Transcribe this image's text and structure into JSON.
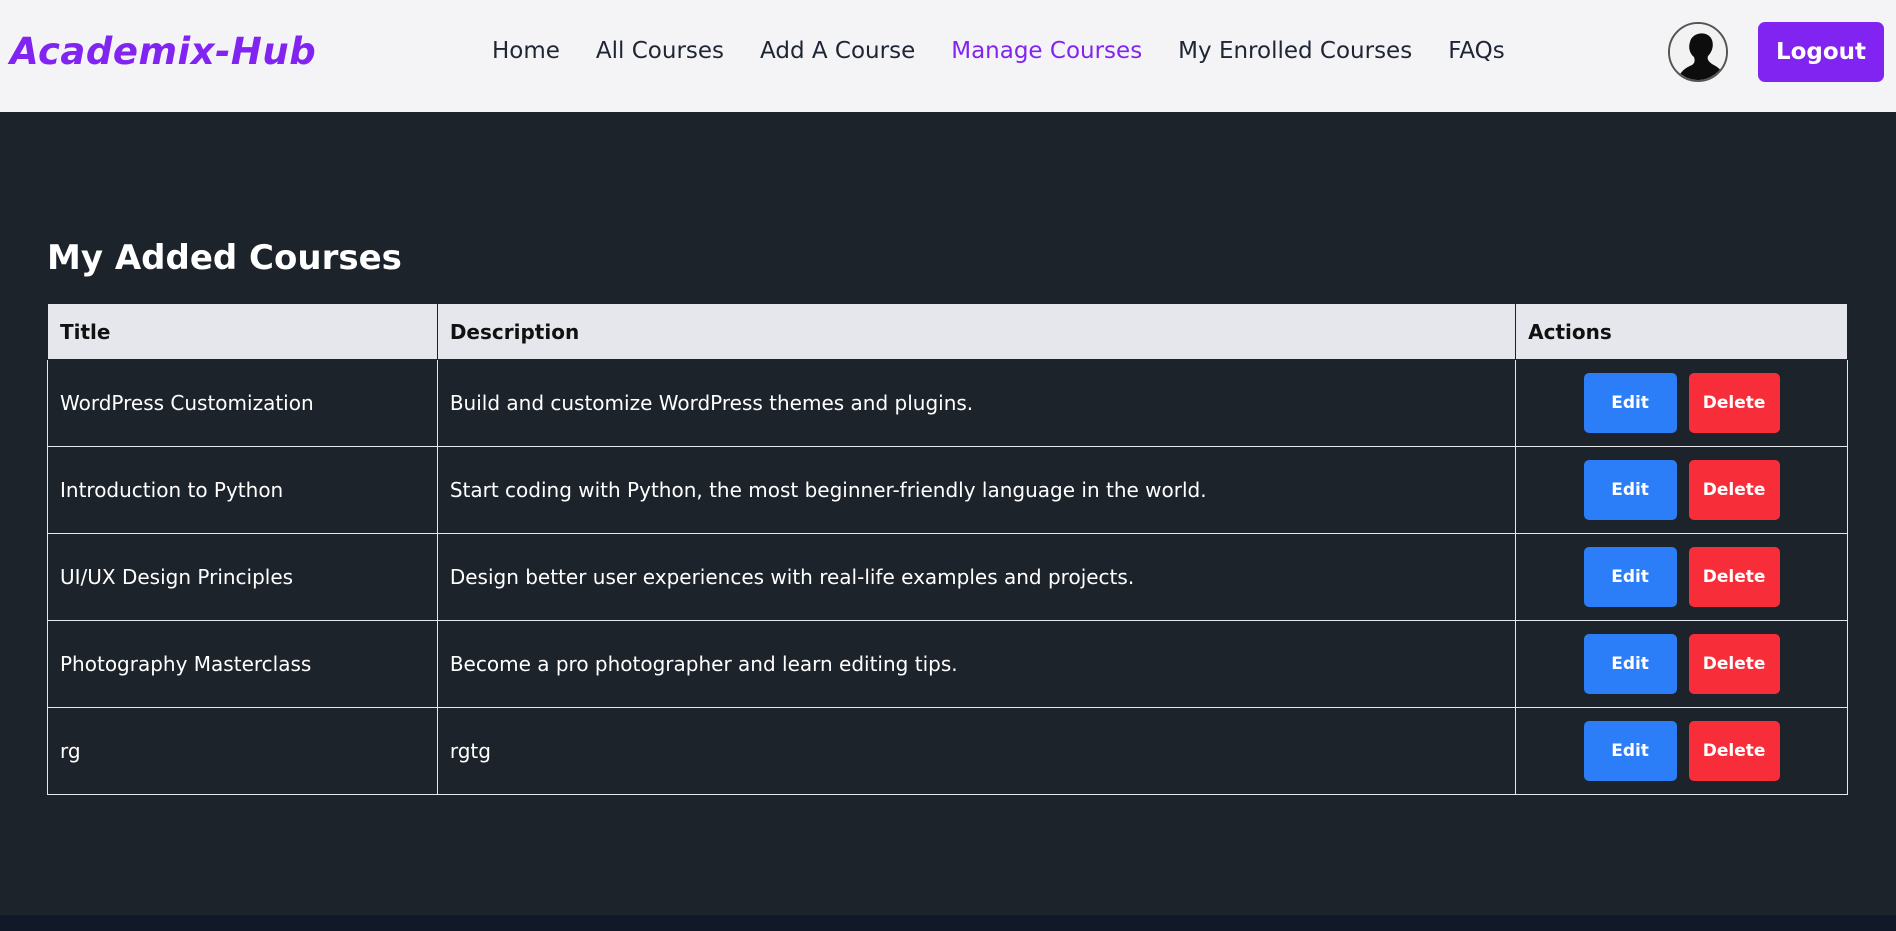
{
  "navbar": {
    "logo": "Academix-Hub",
    "links": [
      {
        "label": "Home",
        "active": false
      },
      {
        "label": "All Courses",
        "active": false
      },
      {
        "label": "Add A Course",
        "active": false
      },
      {
        "label": "Manage Courses",
        "active": true
      },
      {
        "label": "My Enrolled Courses",
        "active": false
      },
      {
        "label": "FAQs",
        "active": false
      }
    ],
    "logout_label": "Logout",
    "accent_color": "#8224f1"
  },
  "main": {
    "title": "My Added Courses",
    "table": {
      "headers": [
        "Title",
        "Description",
        "Actions"
      ],
      "rows": [
        {
          "title": "WordPress Customization",
          "description": "Build and customize WordPress themes and plugins."
        },
        {
          "title": "Introduction to Python",
          "description": "Start coding with Python, the most beginner-friendly language in the world."
        },
        {
          "title": "UI/UX Design Principles",
          "description": "Design better user experiences with real-life examples and projects."
        },
        {
          "title": "Photography Masterclass",
          "description": "Become a pro photographer and learn editing tips."
        },
        {
          "title": "rg",
          "description": "rgtg"
        }
      ],
      "edit_label": "Edit",
      "delete_label": "Delete",
      "edit_color": "#2b7ef8",
      "delete_color": "#f82d3a"
    }
  }
}
